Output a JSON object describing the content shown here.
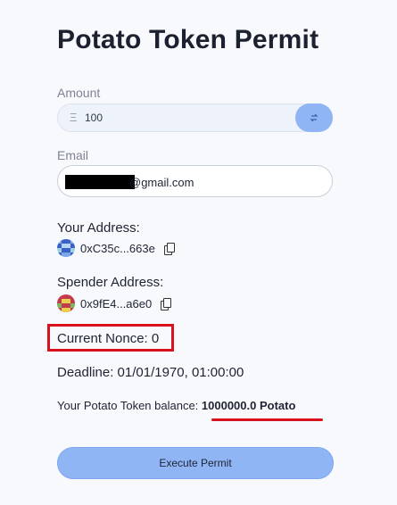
{
  "title": "Potato Token Permit",
  "amount": {
    "label": "Amount",
    "icon": "eth-icon",
    "value": "100",
    "swap_icon": "swap-arrows-icon"
  },
  "email": {
    "label": "Email",
    "value": "@gmail.com"
  },
  "your_address": {
    "label": "Your Address:",
    "value": "0xC35c...663e"
  },
  "spender_address": {
    "label": "Spender Address:",
    "value": "0x9fE4...a6e0"
  },
  "nonce": {
    "text": "Current Nonce: 0"
  },
  "deadline": {
    "text": "Deadline: 01/01/1970, 01:00:00"
  },
  "balance": {
    "prefix": "Your Potato Token balance: ",
    "value": "1000000.0 Potato"
  },
  "execute_button": "Execute Permit",
  "colors": {
    "accent": "#8fb5f5",
    "highlight": "#d9111c",
    "text": "#1f2433"
  }
}
